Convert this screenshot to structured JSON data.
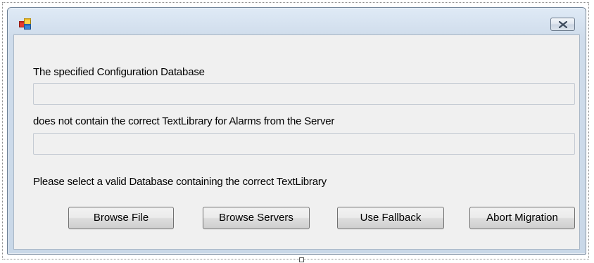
{
  "dialog": {
    "title": "",
    "message1": "The specified Configuration Database",
    "field1_value": "",
    "message2": "does not contain the correct TextLibrary for Alarms from the Server",
    "field2_value": "",
    "message3": "Please select a valid Database containing the correct TextLibrary"
  },
  "buttons": {
    "browse_file": "Browse File",
    "browse_servers": "Browse Servers",
    "use_fallback": "Use Fallback",
    "abort_migration": "Abort Migration"
  },
  "icons": {
    "app": "application-window-icon",
    "close": "close-x-icon"
  }
}
